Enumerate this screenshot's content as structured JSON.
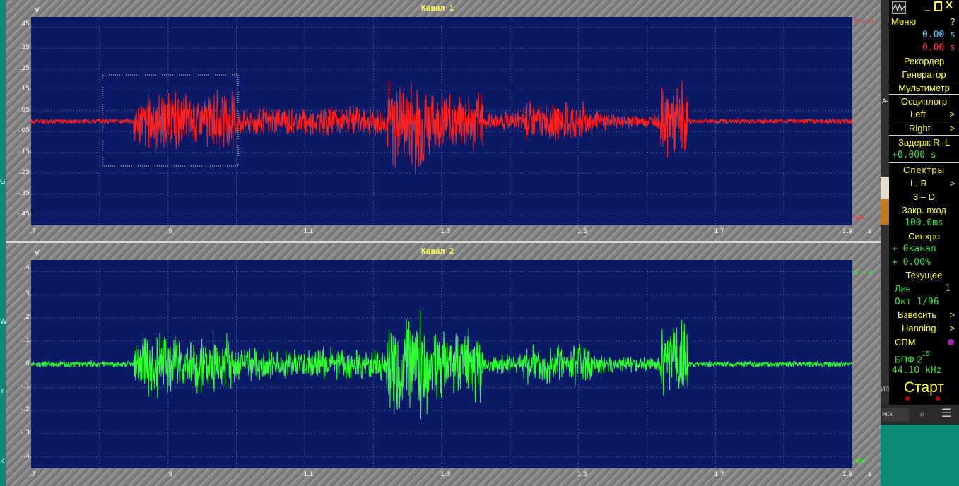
{
  "gutter_letters": [
    "G",
    "W",
    "T",
    "K"
  ],
  "channel1": {
    "title": "Канал 1",
    "unit_v": "V",
    "unit_s": "s",
    "corner_top": "0 = 0",
    "corner_bottom": "◄∏►",
    "yticks": [
      ".45",
      ".35",
      ".25",
      ".15",
      ".05",
      "-.05",
      "-.15",
      "-.25",
      "-.35",
      "-.45"
    ],
    "xticks": [
      ".7",
      ".9",
      "1.1",
      "1.3",
      "1.5",
      "1.7",
      "1.9"
    ],
    "color": "#ff2020"
  },
  "channel2": {
    "title": "Канал 2",
    "unit_v": "V",
    "unit_s": "s",
    "corner_top": "0 = 0",
    "corner_bottom": "◄∏◆",
    "yticks": [
      ".4",
      ".3",
      ".2",
      ".1",
      "0",
      "-.1",
      "-.2",
      "-.3",
      "-.4"
    ],
    "xticks": [
      ".7",
      ".9",
      "1.1",
      "1.3",
      "1.5",
      "1.7",
      "1.9"
    ],
    "color": "#30ff30"
  },
  "panel": {
    "menu": "Меню",
    "help": "?",
    "time1": "0.00  s",
    "time2": "0.00  s",
    "recorder": "Рекордер",
    "generator": "Генератор",
    "multimeter": "Мультиметр",
    "oscilloscope": "Осциплогр",
    "left": "Left",
    "right": "Right",
    "delay": "Задерж R–L",
    "delay_val": "+0.000  s",
    "spectra": "Спектры",
    "lr": "L, R",
    "threed": "3 – D",
    "closed_input": "Закр. вход",
    "closed_val": "100.0ms",
    "sync": "Синхро",
    "sync_ch": "+ 0канал",
    "sync_pct": "+ 0.00%",
    "current": "Текущее",
    "lin": "Лин",
    "lin_val": "1",
    "oct": "Окт  1/96",
    "weigh": "Взвесить",
    "hanning": "Hanning",
    "spm": "СПМ",
    "fft": "БПФ  2",
    "fft_exp": "15",
    "rate": "44.10 kHz",
    "start": "Старт"
  },
  "side_fragments": {
    "a": "A-",
    "mb": "ИВ",
    "search": "иск"
  }
}
